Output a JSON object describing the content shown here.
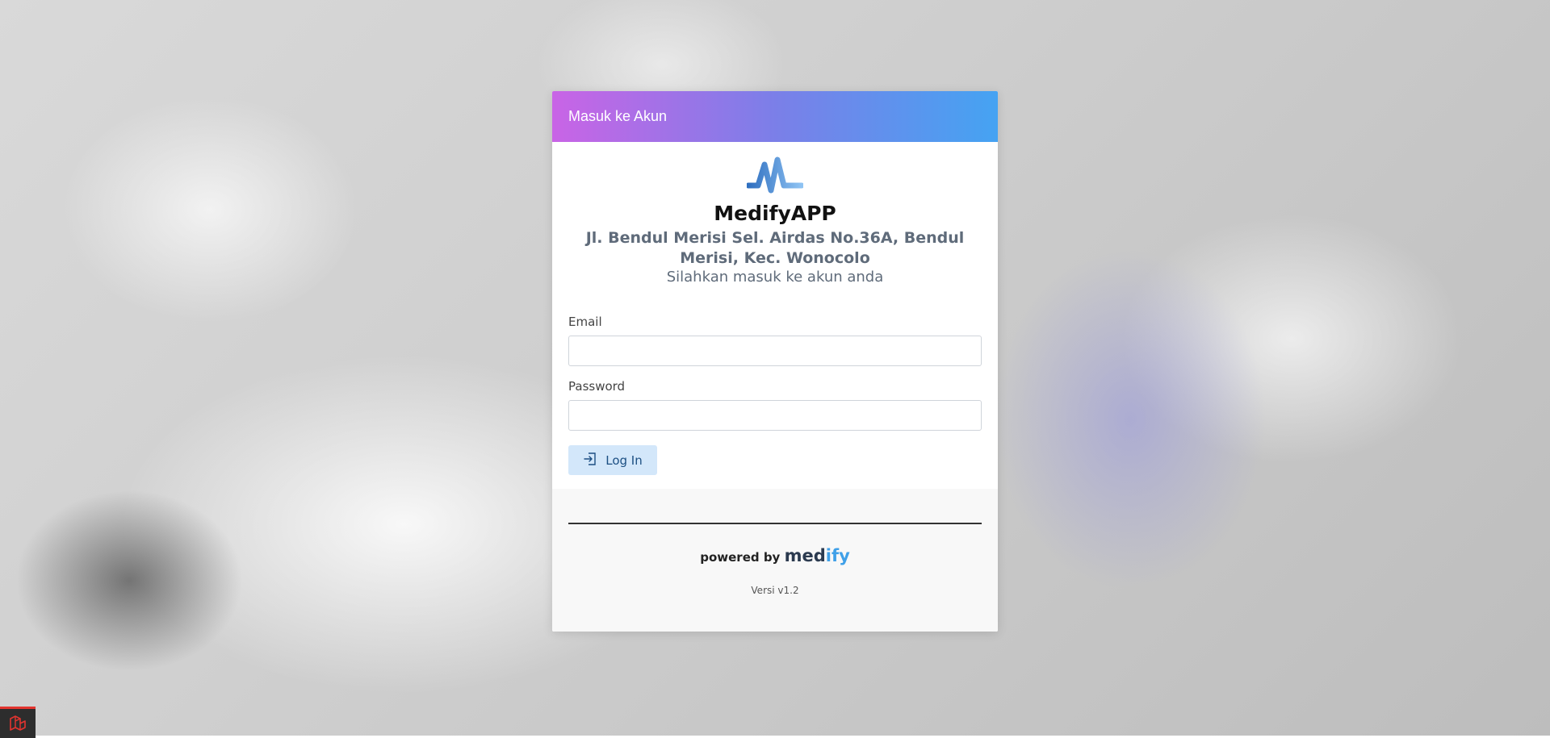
{
  "header": {
    "title": "Masuk ke Akun"
  },
  "brand": {
    "app_name": "MedifyAPP",
    "address": "Jl. Bendul Merisi Sel. Airdas No.36A, Bendul Merisi, Kec. Wonocolo",
    "subtitle": "Silahkan masuk ke akun anda",
    "logo_icon": "pulse-logo-icon"
  },
  "form": {
    "email_label": "Email",
    "email_value": "",
    "email_placeholder": "",
    "password_label": "Password",
    "password_value": "",
    "password_placeholder": "",
    "login_label": "Log In",
    "login_icon": "login-icon"
  },
  "footer": {
    "powered_prefix": "powered by",
    "brand_part1": "med",
    "brand_part2": "ify",
    "version": "Versi v1.2"
  },
  "colors": {
    "header_gradient_start": "#c964e6",
    "header_gradient_mid": "#7b7fe8",
    "header_gradient_end": "#45a3f2",
    "button_bg": "#d3e7fa",
    "brand_dark": "#2b3a4f",
    "brand_accent": "#3fa0e8"
  }
}
